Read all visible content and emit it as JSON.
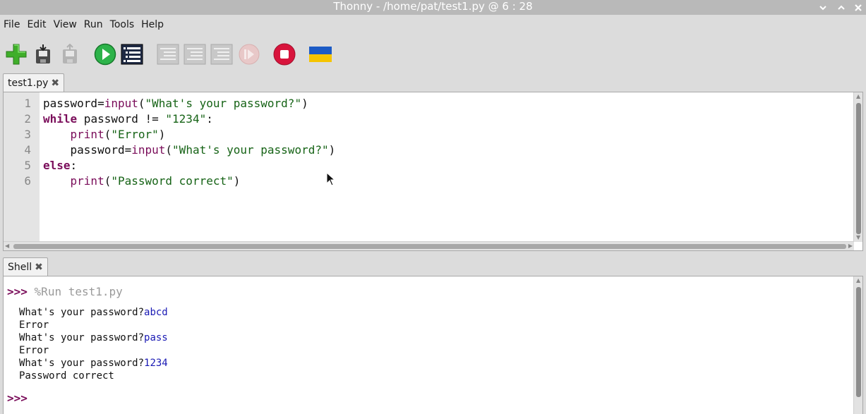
{
  "window": {
    "title": "Thonny  -  /home/pat/test1.py  @  6 : 28"
  },
  "menu": [
    "File",
    "Edit",
    "View",
    "Run",
    "Tools",
    "Help"
  ],
  "toolbar": {
    "icons": [
      "new-file-icon",
      "open-file-icon",
      "save-file-icon",
      "run-icon",
      "debug-icon",
      "step-over-icon",
      "step-into-icon",
      "step-out-icon",
      "resume-icon",
      "stop-icon",
      "ukraine-flag-icon"
    ]
  },
  "editor": {
    "tab_label": "test1.py",
    "line_numbers": [
      "1",
      "2",
      "3",
      "4",
      "5",
      "6"
    ],
    "lines": [
      [
        {
          "t": "password=",
          "c": ""
        },
        {
          "t": "input",
          "c": "fn"
        },
        {
          "t": "(",
          "c": ""
        },
        {
          "t": "\"What's your password?\"",
          "c": "str"
        },
        {
          "t": ")",
          "c": ""
        }
      ],
      [
        {
          "t": "while",
          "c": "kw"
        },
        {
          "t": " password != ",
          "c": ""
        },
        {
          "t": "\"1234\"",
          "c": "str"
        },
        {
          "t": ":",
          "c": ""
        }
      ],
      [
        {
          "t": "    ",
          "c": ""
        },
        {
          "t": "print",
          "c": "fn"
        },
        {
          "t": "(",
          "c": ""
        },
        {
          "t": "\"Error\"",
          "c": "str"
        },
        {
          "t": ")",
          "c": ""
        }
      ],
      [
        {
          "t": "    password=",
          "c": ""
        },
        {
          "t": "input",
          "c": "fn"
        },
        {
          "t": "(",
          "c": ""
        },
        {
          "t": "\"What's your password?\"",
          "c": "str"
        },
        {
          "t": ")",
          "c": ""
        }
      ],
      [
        {
          "t": "else",
          "c": "kw"
        },
        {
          "t": ":",
          "c": ""
        }
      ],
      [
        {
          "t": "    ",
          "c": ""
        },
        {
          "t": "print",
          "c": "fn"
        },
        {
          "t": "(",
          "c": ""
        },
        {
          "t": "\"Password correct\"",
          "c": "str"
        },
        {
          "t": ")",
          "c": ""
        }
      ]
    ]
  },
  "shell": {
    "tab_label": "Shell",
    "prompt": ">>>",
    "run_command": "%Run test1.py",
    "output": [
      {
        "text": "What's your password?",
        "input": "abcd"
      },
      {
        "text": "Error",
        "input": ""
      },
      {
        "text": "What's your password?",
        "input": "pass"
      },
      {
        "text": "Error",
        "input": ""
      },
      {
        "text": "What's your password?",
        "input": "1234"
      },
      {
        "text": "Password correct",
        "input": ""
      }
    ]
  },
  "colors": {
    "keyword": "#7a0d5a",
    "string": "#166316",
    "user_input": "#1a1ab4",
    "stop": "#d8143c",
    "run": "#2db34a"
  }
}
